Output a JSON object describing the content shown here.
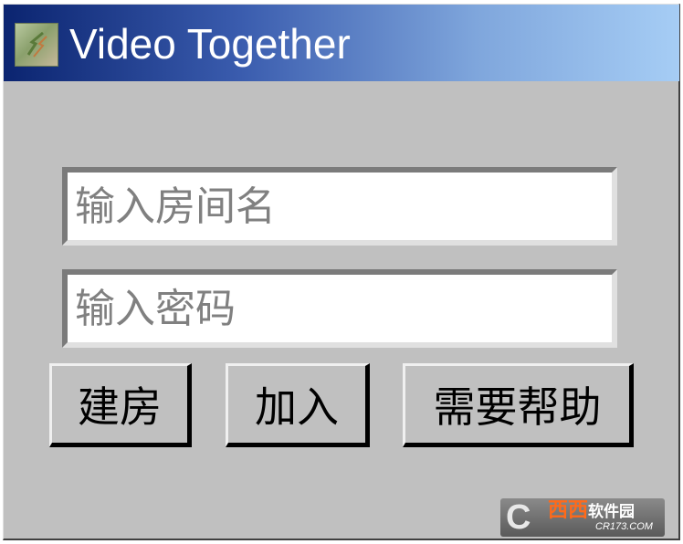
{
  "window": {
    "title": "Video Together",
    "icon": "video-together-app-icon"
  },
  "form": {
    "room_name_placeholder": "输入房间名",
    "password_placeholder": "输入密码",
    "create_room_label": "建房",
    "join_label": "加入",
    "help_label": "需要帮助"
  },
  "watermark": {
    "logo": "C",
    "name": "西西",
    "suffix": "软件园",
    "domain": "CR173.COM"
  },
  "colors": {
    "window_bg": "#c0c0c0",
    "title_gradient_start": "#0b2470",
    "title_gradient_end": "#a6cdf5",
    "title_text": "#ffffff",
    "placeholder_text": "#808080"
  }
}
